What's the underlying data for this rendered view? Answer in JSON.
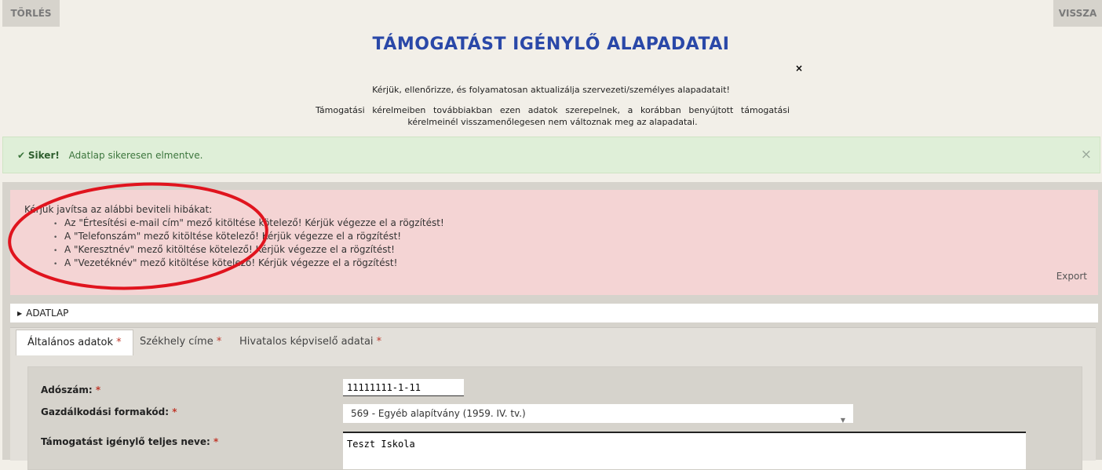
{
  "top_buttons": {
    "torles": "TÖRLÉS",
    "vissza": "VISSZA"
  },
  "header": {
    "title": "TÁMOGATÁST IGÉNYLŐ ALAPADATAI",
    "close_symbol": "×",
    "intro_line1": "Kérjük, ellenőrizze, és folyamatosan aktualizálja szervezeti/személyes alapadatait!",
    "intro_line2": "Támogatási kérelmeiben továbbiakban ezen adatok szerepelnek, a korábban benyújtott támogatási kérelmeinél visszamenőlegesen nem változnak meg az alapadatai."
  },
  "success_alert": {
    "strong": "Siker!",
    "message": "Adatlap sikeresen elmentve.",
    "close": "×",
    "color": "#3c763d"
  },
  "error_box": {
    "heading": "Kérjük javítsa az alábbi beviteli hibákat:",
    "items": [
      "Az \"Értesítési e-mail cím\" mező kitöltése kötelező! Kérjük végezze el a rögzítést!",
      "A \"Telefonszám\" mező kitöltése kötelező! Kérjük végezze el a rögzítést!",
      "A \"Keresztnév\" mező kitöltése kötelező! Kérjük végezze el a rögzítést!",
      "A \"Vezetéknév\" mező kitöltése kötelező! Kérjük végezze el a rögzítést!"
    ],
    "export": "Export",
    "annotation_color": "#e0141e"
  },
  "section": {
    "label": "ADATLAP"
  },
  "tabs": [
    {
      "label": "Általános adatok",
      "required": "*"
    },
    {
      "label": "Székhely címe",
      "required": "*"
    },
    {
      "label": "Hivatalos képviselő adatai",
      "required": "*"
    }
  ],
  "form": {
    "adoszam": {
      "label": "Adószám:",
      "required": "*",
      "value": "11111111-1-11"
    },
    "gazd_forma": {
      "label": "Gazdálkodási formakód:",
      "required": "*",
      "value": "569 - Egyéb alapítvány (1959. IV. tv.)"
    },
    "teljes_nev": {
      "label": "Támogatást igénylő teljes neve:",
      "required": "*",
      "value": "Teszt Iskola"
    }
  },
  "colors": {
    "title": "#2a48a8",
    "error_bg": "#f4d4d4",
    "success_bg": "#dfefd8"
  }
}
